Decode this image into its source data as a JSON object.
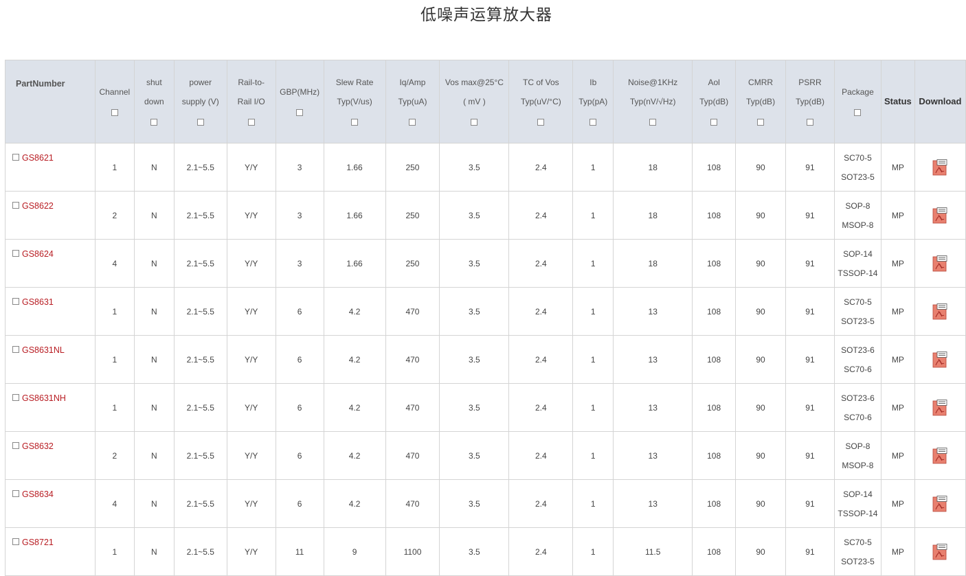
{
  "title": "低噪声运算放大器",
  "columns": [
    {
      "lines": [
        "PartNumber"
      ],
      "checkbox": false
    },
    {
      "lines": [
        "Channel"
      ],
      "checkbox": true
    },
    {
      "lines": [
        "shut",
        "down"
      ],
      "checkbox": true
    },
    {
      "lines": [
        "power",
        "supply (V)"
      ],
      "checkbox": true
    },
    {
      "lines": [
        "Rail-to-",
        "Rail I/O"
      ],
      "checkbox": true
    },
    {
      "lines": [
        "GBP(MHz)"
      ],
      "checkbox": true
    },
    {
      "lines": [
        "Slew Rate",
        "Typ(V/us)"
      ],
      "checkbox": true
    },
    {
      "lines": [
        "Iq/Amp",
        "Typ(uA)"
      ],
      "checkbox": true
    },
    {
      "lines": [
        "Vos max@25°C",
        "( mV )"
      ],
      "checkbox": true
    },
    {
      "lines": [
        "TC of Vos",
        "Typ(uV/°C)"
      ],
      "checkbox": true
    },
    {
      "lines": [
        "Ib",
        "Typ(pA)"
      ],
      "checkbox": true
    },
    {
      "lines": [
        "Noise@1KHz",
        "Typ(nV/√Hz)"
      ],
      "checkbox": true
    },
    {
      "lines": [
        "Aol",
        "Typ(dB)"
      ],
      "checkbox": true
    },
    {
      "lines": [
        "CMRR",
        "Typ(dB)"
      ],
      "checkbox": true
    },
    {
      "lines": [
        "PSRR",
        "Typ(dB)"
      ],
      "checkbox": true
    },
    {
      "lines": [
        "Package"
      ],
      "checkbox": true
    },
    {
      "lines": [
        "Status"
      ],
      "checkbox": false
    },
    {
      "lines": [
        "Download"
      ],
      "checkbox": false
    }
  ],
  "rows": [
    {
      "part": "GS8621",
      "channel": "1",
      "shutdown": "N",
      "supply": "2.1~5.5",
      "rail": "Y/Y",
      "gbp": "3",
      "slew": "1.66",
      "iq": "250",
      "vos": "3.5",
      "tc": "2.4",
      "ib": "1",
      "noise": "18",
      "aol": "108",
      "cmrr": "90",
      "psrr": "91",
      "package": [
        "SC70-5",
        "SOT23-5"
      ],
      "status": "MP"
    },
    {
      "part": "GS8622",
      "channel": "2",
      "shutdown": "N",
      "supply": "2.1~5.5",
      "rail": "Y/Y",
      "gbp": "3",
      "slew": "1.66",
      "iq": "250",
      "vos": "3.5",
      "tc": "2.4",
      "ib": "1",
      "noise": "18",
      "aol": "108",
      "cmrr": "90",
      "psrr": "91",
      "package": [
        "SOP-8",
        "MSOP-8"
      ],
      "status": "MP"
    },
    {
      "part": "GS8624",
      "channel": "4",
      "shutdown": "N",
      "supply": "2.1~5.5",
      "rail": "Y/Y",
      "gbp": "3",
      "slew": "1.66",
      "iq": "250",
      "vos": "3.5",
      "tc": "2.4",
      "ib": "1",
      "noise": "18",
      "aol": "108",
      "cmrr": "90",
      "psrr": "91",
      "package": [
        "SOP-14",
        "TSSOP-14"
      ],
      "status": "MP"
    },
    {
      "part": "GS8631",
      "channel": "1",
      "shutdown": "N",
      "supply": "2.1~5.5",
      "rail": "Y/Y",
      "gbp": "6",
      "slew": "4.2",
      "iq": "470",
      "vos": "3.5",
      "tc": "2.4",
      "ib": "1",
      "noise": "13",
      "aol": "108",
      "cmrr": "90",
      "psrr": "91",
      "package": [
        "SC70-5",
        "SOT23-5"
      ],
      "status": "MP"
    },
    {
      "part": "GS8631NL",
      "channel": "1",
      "shutdown": "N",
      "supply": "2.1~5.5",
      "rail": "Y/Y",
      "gbp": "6",
      "slew": "4.2",
      "iq": "470",
      "vos": "3.5",
      "tc": "2.4",
      "ib": "1",
      "noise": "13",
      "aol": "108",
      "cmrr": "90",
      "psrr": "91",
      "package": [
        "SOT23-6",
        "SC70-6"
      ],
      "status": "MP"
    },
    {
      "part": "GS8631NH",
      "channel": "1",
      "shutdown": "N",
      "supply": "2.1~5.5",
      "rail": "Y/Y",
      "gbp": "6",
      "slew": "4.2",
      "iq": "470",
      "vos": "3.5",
      "tc": "2.4",
      "ib": "1",
      "noise": "13",
      "aol": "108",
      "cmrr": "90",
      "psrr": "91",
      "package": [
        "SOT23-6",
        "SC70-6"
      ],
      "status": "MP"
    },
    {
      "part": "GS8632",
      "channel": "2",
      "shutdown": "N",
      "supply": "2.1~5.5",
      "rail": "Y/Y",
      "gbp": "6",
      "slew": "4.2",
      "iq": "470",
      "vos": "3.5",
      "tc": "2.4",
      "ib": "1",
      "noise": "13",
      "aol": "108",
      "cmrr": "90",
      "psrr": "91",
      "package": [
        "SOP-8",
        "MSOP-8"
      ],
      "status": "MP"
    },
    {
      "part": "GS8634",
      "channel": "4",
      "shutdown": "N",
      "supply": "2.1~5.5",
      "rail": "Y/Y",
      "gbp": "6",
      "slew": "4.2",
      "iq": "470",
      "vos": "3.5",
      "tc": "2.4",
      "ib": "1",
      "noise": "13",
      "aol": "108",
      "cmrr": "90",
      "psrr": "91",
      "package": [
        "SOP-14",
        "TSSOP-14"
      ],
      "status": "MP"
    },
    {
      "part": "GS8721",
      "channel": "1",
      "shutdown": "N",
      "supply": "2.1~5.5",
      "rail": "Y/Y",
      "gbp": "11",
      "slew": "9",
      "iq": "1100",
      "vos": "3.5",
      "tc": "2.4",
      "ib": "1",
      "noise": "11.5",
      "aol": "108",
      "cmrr": "90",
      "psrr": "91",
      "package": [
        "SC70-5",
        "SOT23-5"
      ],
      "status": "MP"
    }
  ],
  "icons": {
    "download": "pdf-icon"
  },
  "colors": {
    "header_bg": "#dde2ea",
    "part_link": "#b81c22",
    "pdf_icon": "#e8806f"
  }
}
